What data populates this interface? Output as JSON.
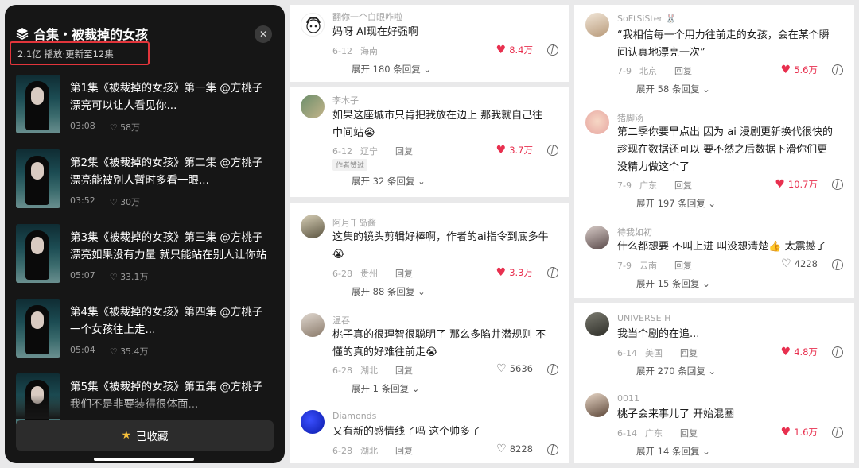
{
  "collection": {
    "title": "合集・被裁掉的女孩",
    "subtitle": "2.1亿 播放·更新至12集",
    "close_icon": "close-icon",
    "episodes": [
      {
        "text": "第1集《被裁掉的女孩》第一集 @方桃子 漂亮可以让人看见你...",
        "duration": "03:08",
        "likes": "58万"
      },
      {
        "text": "第2集《被裁掉的女孩》第二集 @方桃子 漂亮能被别人暂时多看一眼...",
        "duration": "03:52",
        "likes": "30万"
      },
      {
        "text": "第3集《被裁掉的女孩》第三集 @方桃子 漂亮如果没有力量 就只能站在别人让你站的...",
        "duration": "05:07",
        "likes": "33.1万"
      },
      {
        "text": "第4集《被裁掉的女孩》第四集 @方桃子 一个女孩往上走...",
        "duration": "05:04",
        "likes": "35.4万"
      },
      {
        "text": "第5集《被裁掉的女孩》第五集 @方桃子 我们不是非要装得很体面...",
        "duration": "",
        "likes": ""
      }
    ],
    "collect_label": "已收藏"
  },
  "comments": {
    "card1": [
      {
        "user": "翻你一个白眼咋啦",
        "text": "妈呀 AI现在好强啊",
        "date": "6-12",
        "loc": "海南",
        "likes": "8.4万",
        "expand": "展开 180 条回复"
      }
    ],
    "card2": [
      {
        "user": "李木子",
        "text": "如果这座城市只肯把我放在边上 那我就自己往中间站😭",
        "date": "6-12",
        "loc": "辽宁",
        "reply": "回复",
        "likes": "3.7万",
        "badge": "作者赞过",
        "expand": "展开 32 条回复"
      }
    ],
    "card3": [
      {
        "user": "阿月千岛酱",
        "text": "这集的镜头剪辑好棒啊，作者的ai指令到底多牛😭",
        "date": "6-28",
        "loc": "贵州",
        "reply": "回复",
        "likes": "3.3万",
        "expand": "展开 88 条回复"
      },
      {
        "user": "温吞",
        "text": "桃子真的很理智很聪明了 那么多陷井潜规则 不懂的真的好难往前走😭",
        "date": "6-28",
        "loc": "湖北",
        "reply": "回复",
        "likes": "5636",
        "expand": "展开 1 条回复"
      },
      {
        "user": "Diamonds",
        "text": "又有新的感情线了吗 这个帅多了",
        "date": "6-28",
        "loc": "湖北",
        "reply": "回复",
        "likes": "8228"
      }
    ],
    "card4": [
      {
        "user": "SoFtSiSter 🐰",
        "text": "“我相信每一个用力往前走的女孩，会在某个瞬间认真地漂亮一次”",
        "date": "7-9",
        "loc": "北京",
        "reply": "回复",
        "likes": "5.6万",
        "expand": "展开 58 条回复"
      },
      {
        "user": "猪脚汤",
        "text": "第二季你要早点出 因为 ai 漫剧更新换代很快的 趁现在数据还可以 要不然之后数据下滑你们更没精力做这个了",
        "date": "7-9",
        "loc": "广东",
        "reply": "回复",
        "likes": "10.7万",
        "expand": "展开 197 条回复"
      },
      {
        "user": "待我如初",
        "text": "什么都想要 不叫上进 叫没想清楚👍 太震撼了",
        "date": "7-9",
        "loc": "云南",
        "reply": "回复",
        "likes": "4228",
        "expand": "展开 15 条回复"
      }
    ],
    "card5": [
      {
        "user": "UNIVERSE H",
        "text": "我当个剧的在追...",
        "date": "6-14",
        "loc": "美国",
        "reply": "回复",
        "likes": "4.8万",
        "expand": "展开 270 条回复"
      },
      {
        "user": "0011",
        "text": "桃子会来事儿了 开始混圈",
        "date": "6-14",
        "loc": "广东",
        "reply": "回复",
        "likes": "1.6万",
        "expand": "展开 14 条回复"
      }
    ]
  },
  "colors": {
    "accent_red": "#e8304f",
    "highlight_box": "#e2353b",
    "dark_panel": "#161616"
  }
}
